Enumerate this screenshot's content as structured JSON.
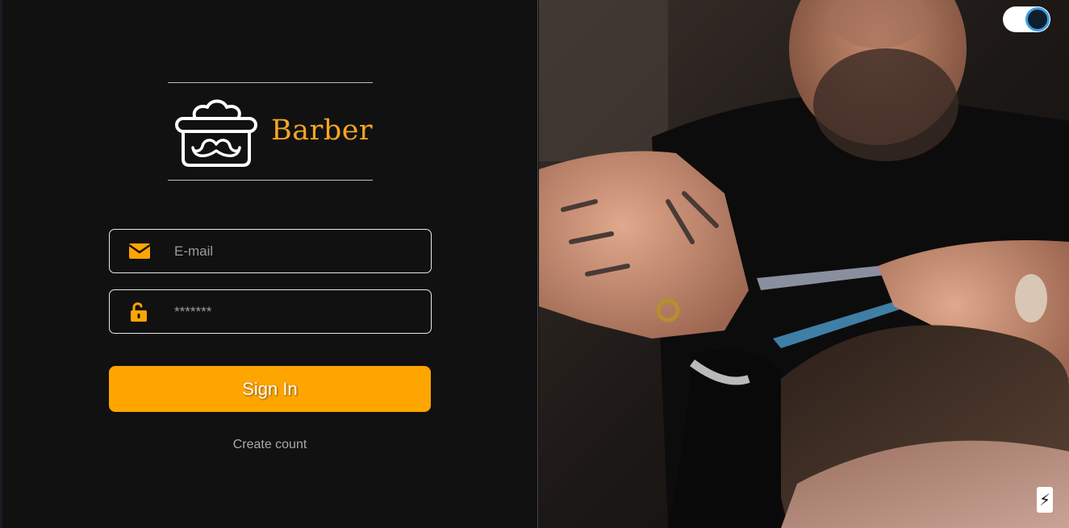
{
  "brand": {
    "name": "Barber",
    "color": "#f5a623",
    "logo_icon": "pomade-jar-mustache-icon"
  },
  "form": {
    "email": {
      "placeholder": "E-mail",
      "value": "",
      "icon": "envelope-icon"
    },
    "password": {
      "placeholder": "*******",
      "value": "",
      "icon": "unlock-icon"
    },
    "submit_label": "Sign In",
    "create_account_label": "Create count"
  },
  "theme_toggle": {
    "state": "dark",
    "icon": "toggle-switch"
  },
  "hero_image": {
    "subject": "barber cutting hair with scissors and comb"
  },
  "colors": {
    "accent": "#ffa500",
    "background": "#121112",
    "toggle_ring": "#3aa0e8"
  },
  "badge": {
    "icon": "lightning-bolt-icon",
    "glyph": "⚡"
  }
}
